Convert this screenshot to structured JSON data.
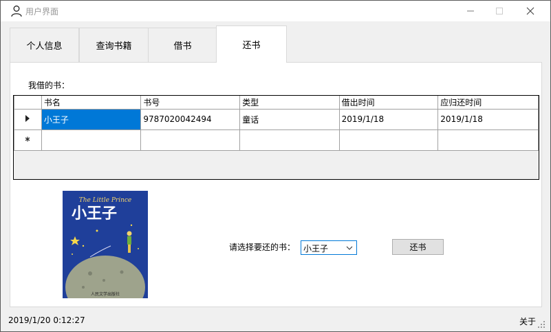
{
  "window": {
    "title": "用户界面"
  },
  "tabs": [
    {
      "label": "个人信息",
      "active": false
    },
    {
      "label": "查询书籍",
      "active": false
    },
    {
      "label": "借书",
      "active": false
    },
    {
      "label": "还书",
      "active": true
    }
  ],
  "panel": {
    "section_label": "我借的书：",
    "grid": {
      "columns": [
        "书名",
        "书号",
        "类型",
        "借出时间",
        "应归还时间"
      ],
      "rows": [
        [
          "小王子",
          "9787020042494",
          "童话",
          "2019/1/18",
          "2019/1/18"
        ]
      ]
    },
    "cover": {
      "title_en": "The Little Prince",
      "title_cn": "小王子",
      "publisher": "人民文学出版社",
      "background_color": "#1f3f9a"
    },
    "choose_label": "请选择要还的书：",
    "combo_value": "小王子",
    "return_button": "还书"
  },
  "statusbar": {
    "time": "2019/1/20 0:12:27",
    "about": "关于"
  },
  "colors": {
    "selection": "#0078d7",
    "window_bg": "#f0f0f0"
  }
}
